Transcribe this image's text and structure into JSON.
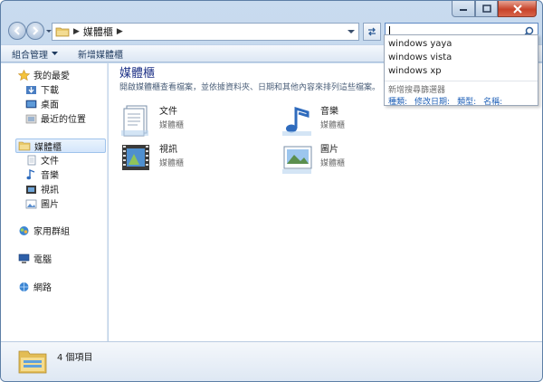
{
  "address": {
    "segments": [
      "媒體櫃"
    ]
  },
  "toolbar": {
    "organize": "組合管理",
    "new_library": "新增媒體櫃"
  },
  "search": {
    "value": "",
    "suggestions": [
      "windows yaya",
      "windows vista",
      "windows xp"
    ],
    "filter_title": "新增搜尋篩選器",
    "filters": [
      "種類:",
      "修改日期:",
      "類型:",
      "名稱:"
    ]
  },
  "sidebar": {
    "favorites": {
      "label": "我的最愛",
      "items": [
        "下載",
        "桌面",
        "最近的位置"
      ]
    },
    "libraries": {
      "label": "媒體櫃",
      "items": [
        "文件",
        "音樂",
        "視訊",
        "圖片"
      ]
    },
    "homegroup": "家用群組",
    "computer": "電腦",
    "network": "網路"
  },
  "main": {
    "title": "媒體櫃",
    "subtitle": "開啟媒體櫃查看檔案，並依據資料夾、日期和其他內容來排列這些檔案。",
    "items": [
      {
        "name": "文件",
        "kind": "媒體櫃"
      },
      {
        "name": "音樂",
        "kind": "媒體櫃"
      },
      {
        "name": "視訊",
        "kind": "媒體櫃"
      },
      {
        "name": "圖片",
        "kind": "媒體櫃"
      }
    ]
  },
  "status": {
    "count": "4 個項目"
  },
  "colors": {
    "accent": "#1e3287",
    "link": "#1d5fb7",
    "close": "#c7432a"
  }
}
